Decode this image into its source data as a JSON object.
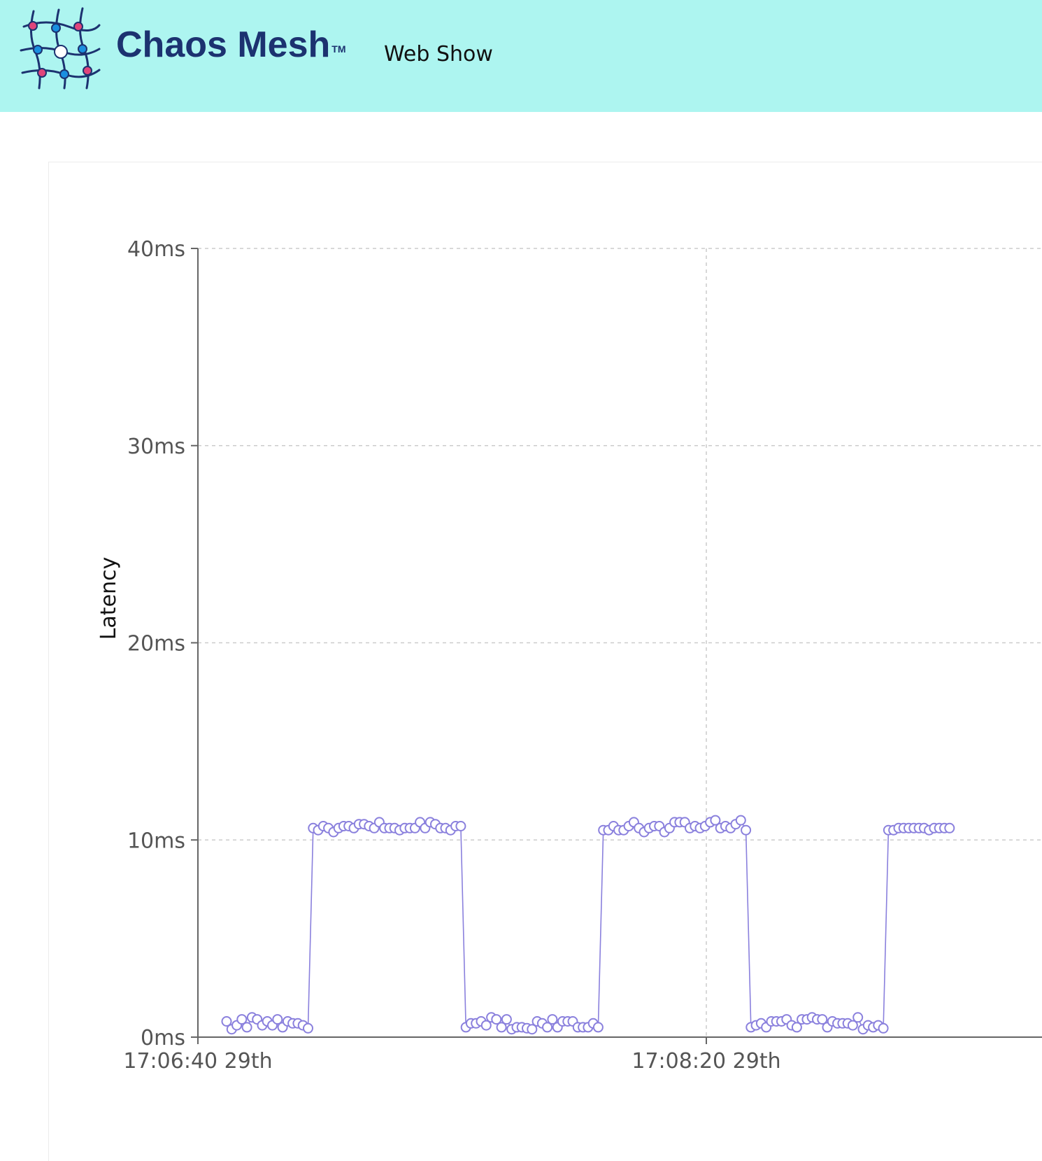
{
  "header": {
    "brand": "Chaos Mesh",
    "trademark": "TM",
    "subtitle": "Web Show",
    "background_color": "#adf5f0",
    "brand_color": "#1c3270",
    "logo_icon": "chaos-mesh-grid-logo"
  },
  "chart_data": {
    "type": "line",
    "ylabel": "Latency",
    "y_unit": "ms",
    "ylim": [
      0,
      40
    ],
    "y_ticks": [
      0,
      10,
      20,
      30,
      40
    ],
    "y_tick_labels": [
      "0ms",
      "10ms",
      "20ms",
      "30ms",
      "40ms"
    ],
    "x_ticks": [
      {
        "time": "17:06:40",
        "label": "17:06:40 29th"
      },
      {
        "time": "17:08:20",
        "label": "17:08:20 29th"
      }
    ],
    "grid": true,
    "series_color": "#8a80dd",
    "series": [
      {
        "values": [
          0.8,
          0.4,
          0.6,
          0.9,
          0.5,
          1.0,
          0.9,
          0.6,
          0.8,
          0.6,
          0.9,
          0.5,
          0.8,
          0.7,
          0.7,
          0.6,
          0.45,
          10.6,
          10.5,
          10.7,
          10.6,
          10.4,
          10.6,
          10.7,
          10.7,
          10.6,
          10.8,
          10.8,
          10.7,
          10.6,
          10.9,
          10.6,
          10.6,
          10.6,
          10.5,
          10.6,
          10.6,
          10.6,
          10.9,
          10.6,
          10.9,
          10.8,
          10.6,
          10.6,
          10.5,
          10.7,
          10.7,
          0.5,
          0.7,
          0.7,
          0.8,
          0.6,
          1.0,
          0.9,
          0.5,
          0.9,
          0.4,
          0.5,
          0.5,
          0.45,
          0.4,
          0.8,
          0.7,
          0.5,
          0.9,
          0.5,
          0.8,
          0.8,
          0.8,
          0.5,
          0.5,
          0.5,
          0.7,
          0.5,
          10.5,
          10.5,
          10.7,
          10.5,
          10.5,
          10.7,
          10.9,
          10.6,
          10.4,
          10.6,
          10.7,
          10.7,
          10.4,
          10.6,
          10.9,
          10.9,
          10.9,
          10.6,
          10.7,
          10.6,
          10.7,
          10.9,
          11.0,
          10.6,
          10.7,
          10.6,
          10.8,
          11.0,
          10.5,
          0.5,
          0.6,
          0.7,
          0.5,
          0.8,
          0.8,
          0.8,
          0.9,
          0.6,
          0.5,
          0.9,
          0.9,
          1.0,
          0.9,
          0.9,
          0.5,
          0.8,
          0.7,
          0.7,
          0.7,
          0.6,
          1.0,
          0.4,
          0.6,
          0.5,
          0.6,
          0.45,
          10.5,
          10.5,
          10.6,
          10.6,
          10.6,
          10.6,
          10.6,
          10.6,
          10.5,
          10.6,
          10.6,
          10.6,
          10.6
        ]
      }
    ]
  }
}
